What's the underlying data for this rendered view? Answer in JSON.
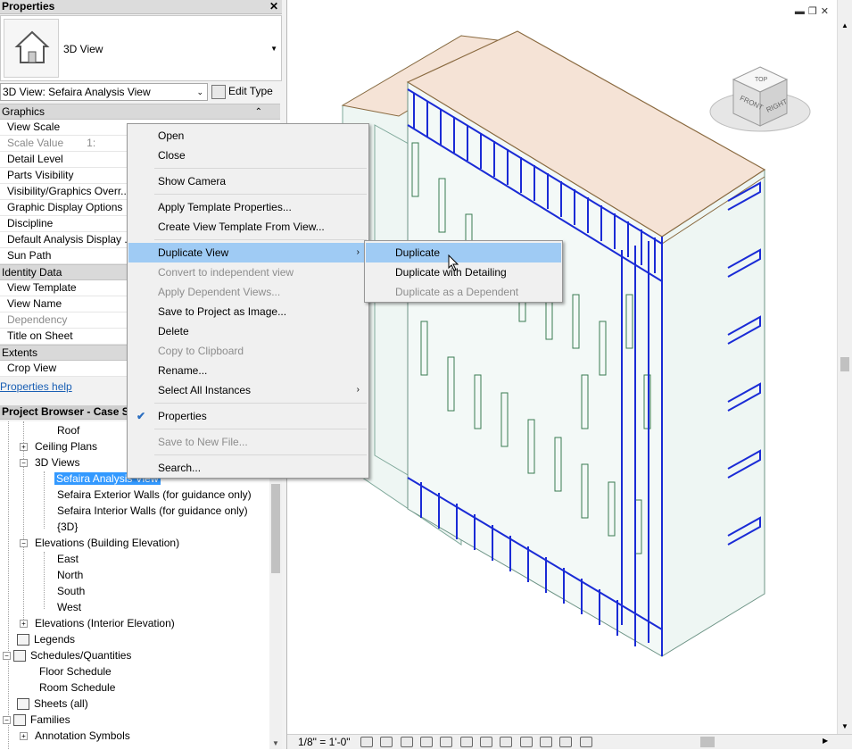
{
  "properties": {
    "title": "Properties",
    "type_label": "3D View",
    "view_selector": "3D View: Sefaira Analysis View",
    "edit_type": "Edit Type",
    "groups": {
      "graphics": "Graphics",
      "identity": "Identity Data",
      "extents": "Extents"
    },
    "rows": {
      "view_scale": "View Scale",
      "scale_value": "Scale Value",
      "scale_value_val": "1:",
      "detail_level": "Detail Level",
      "parts_visibility": "Parts Visibility",
      "vg_overrides": "Visibility/Graphics Overr...",
      "graphic_display": "Graphic Display Options",
      "discipline": "Discipline",
      "default_analysis": "Default Analysis Display ...",
      "sun_path": "Sun Path",
      "view_template": "View Template",
      "view_name": "View Name",
      "dependency": "Dependency",
      "title_on_sheet": "Title on Sheet",
      "crop_view": "Crop View"
    },
    "help_link": "Properties help"
  },
  "browser": {
    "title": "Project Browser - Case Stud",
    "items": {
      "roof": "Roof",
      "ceiling_plans": "Ceiling Plans",
      "views_3d": "3D Views",
      "sefaira_analysis": "Sefaira Analysis View",
      "sefaira_ext": "Sefaira Exterior Walls (for guidance only)",
      "sefaira_int": "Sefaira Interior Walls (for guidance only)",
      "default_3d": "{3D}",
      "elev_building": "Elevations (Building Elevation)",
      "east": "East",
      "north": "North",
      "south": "South",
      "west": "West",
      "elev_interior": "Elevations (Interior Elevation)",
      "legends": "Legends",
      "schedules": "Schedules/Quantities",
      "floor_schedule": "Floor Schedule",
      "room_schedule": "Room Schedule",
      "sheets": "Sheets (all)",
      "families": "Families",
      "annotation_symbols": "Annotation Symbols"
    }
  },
  "context_menu": {
    "open": "Open",
    "close": "Close",
    "show_camera": "Show Camera",
    "apply_template": "Apply Template Properties...",
    "create_template": "Create View Template From View...",
    "duplicate_view": "Duplicate View",
    "convert_independent": "Convert to independent view",
    "apply_dependent": "Apply Dependent Views...",
    "save_image": "Save to Project as Image...",
    "delete": "Delete",
    "copy_clipboard": "Copy to Clipboard",
    "rename": "Rename...",
    "select_all": "Select All Instances",
    "properties": "Properties",
    "save_new_file": "Save to New File...",
    "search": "Search..."
  },
  "submenu": {
    "duplicate": "Duplicate",
    "duplicate_detailing": "Duplicate with Detailing",
    "duplicate_dependent": "Duplicate as a Dependent"
  },
  "viewcube": {
    "top": "TOP",
    "front": "FRONT",
    "right": "RIGHT"
  },
  "view_control_bar": {
    "scale": "1/8\" = 1'-0\""
  },
  "colors": {
    "highlight": "#9fcbf4",
    "selection": "#3399ff",
    "roof": "#f5e3d6",
    "facade": "#eef6f3",
    "window_frame": "#1a2bd6"
  }
}
